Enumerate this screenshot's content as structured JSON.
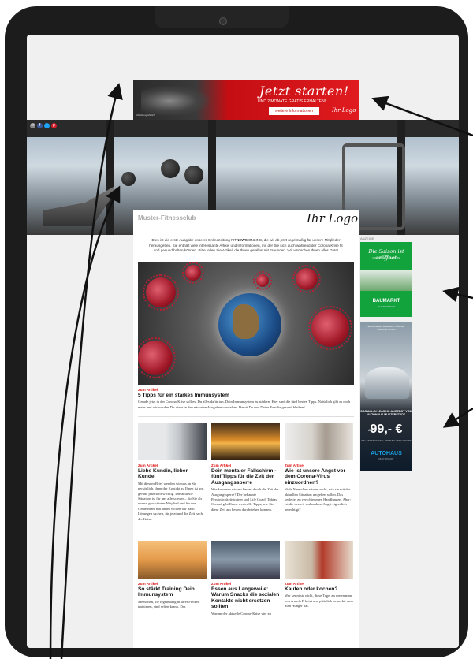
{
  "top_ad": {
    "headline": "Jetzt starten!",
    "sub": "UND 2 MONATE GRATIS ERHALTEN!",
    "button": "weitere Informationen",
    "logo": "Ihr Logo",
    "caption": "Abbildung ähnlich"
  },
  "social_colors": [
    "#888888",
    "#3b5998",
    "#1da1f2",
    "#d11c2a"
  ],
  "header": {
    "club_name": "Muster-Fitnessclub",
    "logo": "Ihr Logo"
  },
  "intro": {
    "text_a": "Dies ist die erste Ausgabe unserer Onlinezeitung FIT",
    "text_bold": "NEWS",
    "text_b": " ONLINE, die wir ab jetzt regelmäßig für unsere Mitglieder herausgeben. Sie enthält viele interessante Artikel und Informationen, mit der Sie sich auch während der Corona-Krise fit und gesund halten können. Bitte teilen Sie Artikel, die Ihnen gefallen mit Freunden. Wir wünschen Ihnen alles Gute!"
  },
  "main_article": {
    "tag": "Zum Artikel",
    "title": "5 Tipps für ein starkes Immunsystem",
    "body": "Gerade jetzt in der Corona-Krise solltest Du alles dafür tun, Dein Immunsystem zu stärken! Hier sind die fünf besten Tipps. Natürlich gibt es noch mehr und wir werden Dir diese in den nächsten Ausgaben vorstellen. Damit Du und Deine Familie gesund bleiben!"
  },
  "row1": [
    {
      "tag": "Zum Artikel",
      "title": "Liebe Kundin, lieber Kunde!",
      "body": "Mit diesem Brief wenden wir uns an Sie persönlich, denn der Kontakt zu Ihnen ist uns gerade jetzt sehr wichtig. Die aktuelle Situation ist für uns alle schwer – für Sie als unsere geschätzten Mitglied und für uns. Gemeinsam mit Ihnen wollen wir nach Lösungen suchen, für jetzt und die Zeit nach der Krise."
    },
    {
      "tag": "Zum Artikel",
      "title": "Dein mentaler Fallschirm - fünf Tipps für die Zeit der Ausgangssperre",
      "body": "Wie kommen wir am besten durch die Zeit der Ausgangssperre? Der bekannte Persönlichkeitstrainer und Life Coach Tobias Conrad gibt Ihnen wertvolle Tipps, wie Sie diese Zeit am besten durchstehen können."
    },
    {
      "tag": "Zum Artikel",
      "title": "Wie ist unsere Angst vor dem Corona-Virus einzuordnen?",
      "body": "Viele Menschen wissen nicht, wie sie mit der aktuellen Situation umgehen sollen. Das verleitet zu verschiedenen Handlungen. Aber: Ist die derzeit vorhandene Angst eigentlich berechtigt?"
    }
  ],
  "row2": [
    {
      "tag": "Zum Artikel",
      "title": "So stärkt Training Dein Immunsystem",
      "body": "Menschen, die regelmäßig in ihrer Freizeit trainieren, sind selten krank. Das"
    },
    {
      "tag": "Zum Artikel",
      "title": "Essen aus Langeweile: Warum Snacks die sozialen Kontakte nicht ersetzen sollten",
      "body": "Warum der aktuelle Corona-Krise viel zu"
    },
    {
      "tag": "Zum Artikel",
      "title": "Kaufen oder kochen?",
      "body": "Wer kennt sie nicht, diese Tage, an denen man von A nach B hetzt und plötzlich bemerkt, dass man Hunger hat."
    }
  ],
  "sidebar": {
    "label": "ANZEIGE",
    "ad1": {
      "script": "Die Saison ist eröffnet",
      "sub": "FRÜHLINGS-ANGEBOTE",
      "name": "BAUMARKT",
      "name_sub": "MUSTERSTADT"
    },
    "ad2": {
      "top": "EXKLUSIVES ANGEBOT FÜR DIE ÖFFENTLICHEN",
      "lease": "DAS ALL-IN LEASING ANGEBOT VOM AUTOHAUS MUSTERSTADT",
      "price": "99,- €",
      "ab": "AB",
      "fine": "INKL. VERSICHERUNG, WARTUNG UND GARANTIE",
      "dealer": "AUTOHAUS",
      "dealer_sub": "MUSTERSTADT"
    }
  },
  "colors": {
    "accent_red": "#d11111",
    "ad_green": "#12a33c",
    "tablet_frame": "#1c1c1c"
  }
}
